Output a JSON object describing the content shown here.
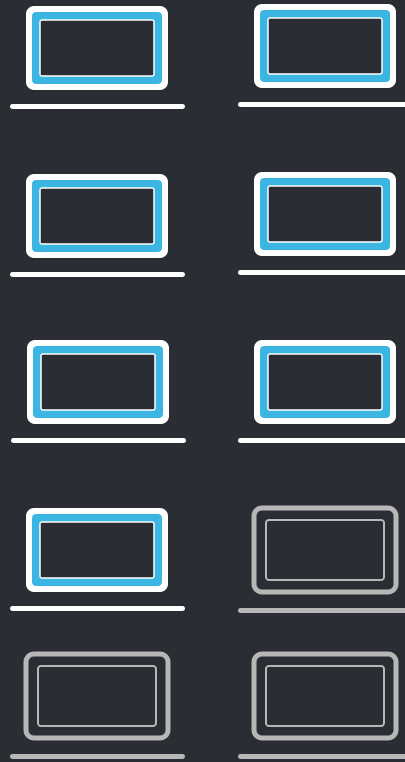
{
  "colors": {
    "background": "#2a2d33",
    "active_fill": "#3bb6e3",
    "active_outline": "#ffffff",
    "inactive_outline": "#b7b7b7",
    "screen_fill": "#2a2d33"
  },
  "laptop_icon": "laptop-icon",
  "laptops": [
    {
      "state": "active"
    },
    {
      "state": "active"
    },
    {
      "state": "active"
    },
    {
      "state": "active"
    },
    {
      "state": "active"
    },
    {
      "state": "active"
    },
    {
      "state": "active"
    },
    {
      "state": "inactive"
    },
    {
      "state": "inactive"
    },
    {
      "state": "inactive"
    }
  ]
}
